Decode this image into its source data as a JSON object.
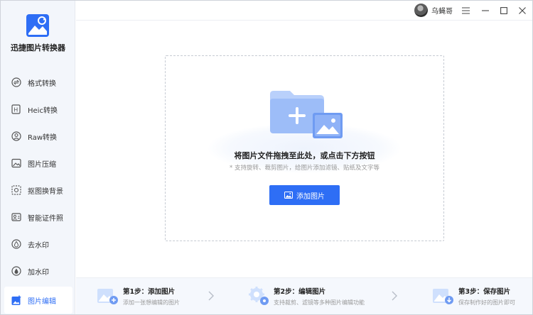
{
  "app": {
    "title": "迅捷图片转换器"
  },
  "sidebar": {
    "items": [
      {
        "label": "格式转换",
        "icon": "format-convert-icon"
      },
      {
        "label": "Heic转换",
        "icon": "heic-icon"
      },
      {
        "label": "Raw转换",
        "icon": "raw-icon"
      },
      {
        "label": "图片压缩",
        "icon": "image-compress-icon"
      },
      {
        "label": "抠图换背景",
        "icon": "cutout-icon"
      },
      {
        "label": "智能证件照",
        "icon": "id-photo-icon"
      },
      {
        "label": "去水印",
        "icon": "remove-watermark-icon"
      },
      {
        "label": "加水印",
        "icon": "add-watermark-icon"
      },
      {
        "label": "图片编辑",
        "icon": "image-edit-icon",
        "active": true
      }
    ]
  },
  "titlebar": {
    "username": "乌蝇哥"
  },
  "dropzone": {
    "title": "将图片文件拖拽至此处，或点击下方按钮",
    "subtitle": "* 支持旋转、裁剪图片，给图片添加滤镜、贴纸及文字等",
    "button_label": "添加图片"
  },
  "steps": [
    {
      "title": "第1步：添加图片",
      "desc": "添加一张想编辑的图片"
    },
    {
      "title": "第2步：编辑图片",
      "desc": "支持裁剪、滤镜等多种图片编辑功能"
    },
    {
      "title": "第3步：保存图片",
      "desc": "保存制作好的图片即可"
    }
  ],
  "colors": {
    "accent": "#2e6ef5",
    "sidebar_bg": "#f3f6fb"
  }
}
